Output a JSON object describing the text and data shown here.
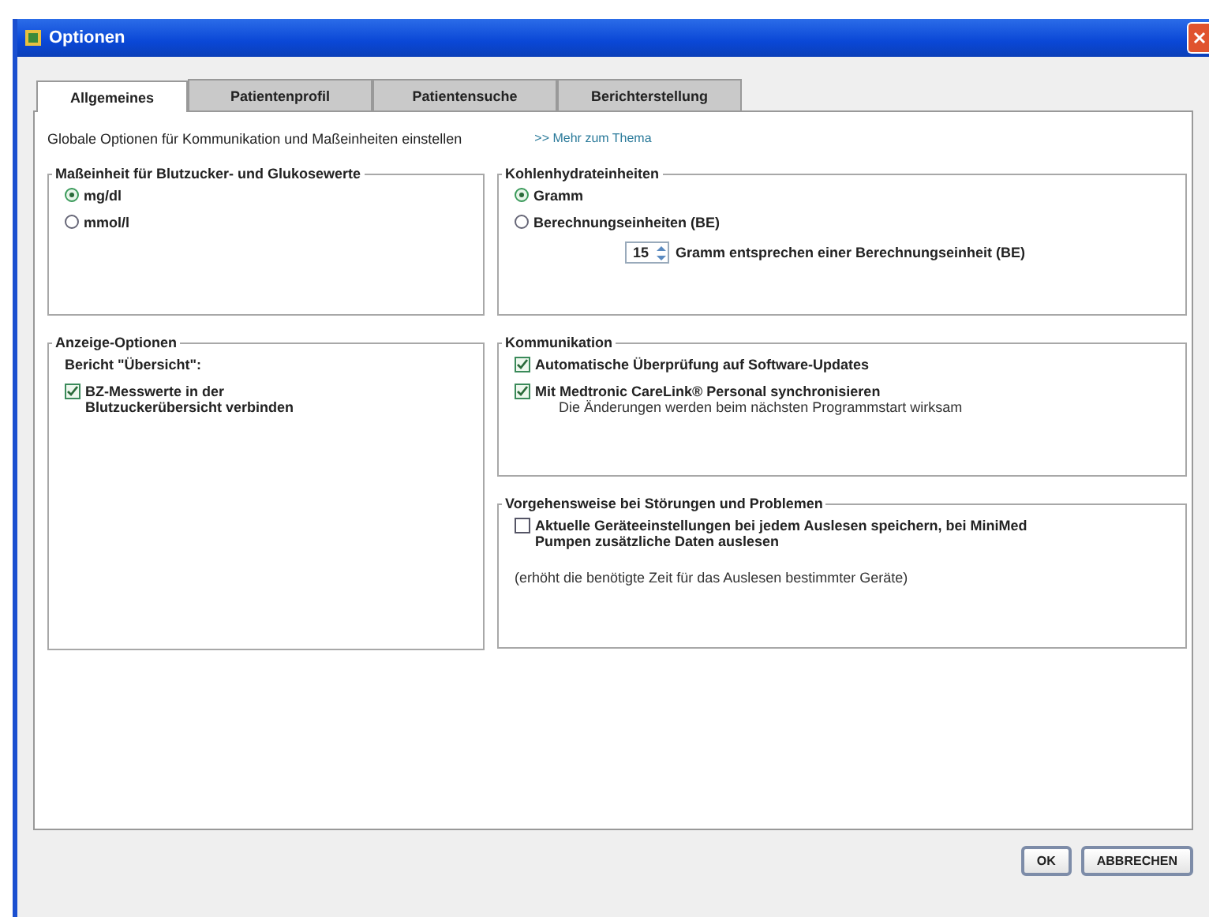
{
  "window": {
    "title": "Optionen"
  },
  "tabs": [
    {
      "label": "Allgemeines",
      "selected": true
    },
    {
      "label": "Patientenprofil",
      "selected": false
    },
    {
      "label": "Patientensuche",
      "selected": false
    },
    {
      "label": "Berichterstellung",
      "selected": false
    }
  ],
  "intro": {
    "text": "Globale Optionen für Kommunikation und Maßeinheiten einstellen",
    "link": ">> Mehr zum Thema"
  },
  "left_groups": [
    {
      "title": "Maßeinheit für Blutzucker- und Glukosewerte",
      "items": [
        {
          "kind": "radio",
          "label": "mg/dl",
          "selected": true
        },
        {
          "kind": "radio",
          "label": "mmol/l",
          "selected": false
        }
      ]
    },
    {
      "title": "Anzeige-Optionen",
      "items": [
        {
          "kind": "heading",
          "text": "Bericht \"Übersicht\":"
        },
        {
          "kind": "checkbox",
          "label": "BZ-Messwerte in der Blutzuckerübersicht verbinden",
          "checked": true
        }
      ]
    }
  ],
  "right_groups": [
    {
      "title": "Kohlenhydrateinheiten",
      "items": [
        {
          "kind": "radio",
          "label": "Gramm",
          "selected": true
        },
        {
          "kind": "radio",
          "label": "Berechnungseinheiten (BE)",
          "selected": false
        },
        {
          "kind": "spinner",
          "value": "15",
          "label": "Gramm entsprechen einer Berechnungseinheit (BE)"
        }
      ]
    },
    {
      "title": "Kommunikation",
      "items": [
        {
          "kind": "checkbox",
          "label": "Automatische Überprüfung auf Software-Updates",
          "checked": true
        },
        {
          "kind": "checkbox",
          "label": "Mit Medtronic CareLink® Personal synchronisieren",
          "checked": true,
          "note": "Die Änderungen werden beim nächsten Programmstart wirksam"
        }
      ]
    },
    {
      "title": "Vorgehensweise bei Störungen und Problemen",
      "items": [
        {
          "kind": "checkbox",
          "label": "Aktuelle Geräteeinstellungen bei jedem Auslesen speichern, bei MiniMed Pumpen zusätzliche Daten auslesen",
          "checked": false
        },
        {
          "kind": "hint",
          "text": "(erhöht die benötigte Zeit für das Auslesen bestimmter Geräte)"
        }
      ]
    }
  ],
  "buttons": [
    "OK",
    "ABBRECHEN"
  ]
}
